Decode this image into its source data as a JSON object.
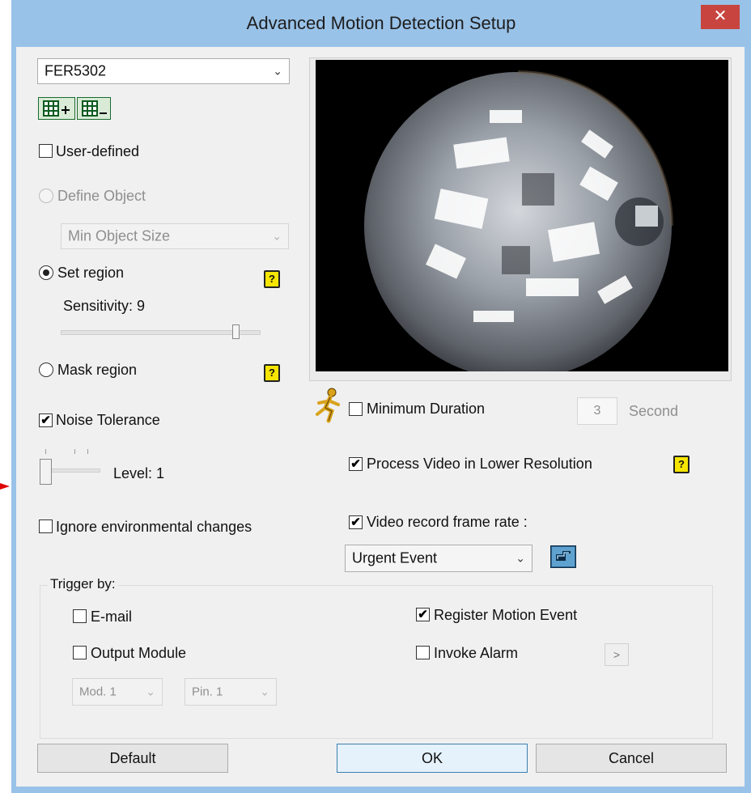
{
  "window": {
    "title": "Advanced Motion Detection Setup",
    "close_glyph": "✕"
  },
  "camera_select": {
    "value": "FER5302"
  },
  "add_region_icon": "grid-add-icon",
  "remove_region_icon": "grid-remove-icon",
  "user_defined": {
    "label": "User-defined",
    "checked": false
  },
  "define_object": {
    "label": "Define Object",
    "enabled": false
  },
  "object_size_select": {
    "value": "Min Object Size",
    "enabled": false
  },
  "set_region": {
    "label": "Set region",
    "selected": true
  },
  "sensitivity": {
    "label": "Sensitivity: 9",
    "value": 9,
    "fraction": 0.9
  },
  "mask_region": {
    "label": "Mask region",
    "selected": false
  },
  "noise_tolerance": {
    "label": "Noise Tolerance",
    "checked": true
  },
  "noise_level": {
    "label": "Level: 1",
    "value": 1
  },
  "ignore_env": {
    "label": "Ignore environmental changes",
    "checked": false
  },
  "minimum_duration": {
    "label": "Minimum Duration",
    "checked": false,
    "value": "3",
    "unit": "Second",
    "icon": "running-man-icon"
  },
  "lower_resolution": {
    "label": "Process Video in Lower Resolution",
    "checked": true
  },
  "frame_rate": {
    "label": "Video record frame rate :",
    "checked": true,
    "select_value": "Urgent Event",
    "config_icon": "pointing-hand-icon"
  },
  "help_glyph": "?",
  "trigger": {
    "group_label": "Trigger by:",
    "email": {
      "label": "E-mail",
      "checked": false
    },
    "output_module": {
      "label": "Output Module",
      "checked": false
    },
    "module_select": "Mod. 1",
    "pin_select": "Pin. 1",
    "register_motion": {
      "label": "Register Motion Event",
      "checked": true
    },
    "invoke_alarm": {
      "label": "Invoke Alarm",
      "checked": false
    },
    "alarm_more": ">"
  },
  "buttons": {
    "default": "Default",
    "ok": "OK",
    "cancel": "Cancel"
  },
  "check_glyph": "✔",
  "dropdown_glyph": "⌄",
  "colors": {
    "title_bar": "#99c2e8",
    "close_button": "#c8453f",
    "help_badge": "#f5e500",
    "dialog_bg": "#f0f0f0"
  }
}
